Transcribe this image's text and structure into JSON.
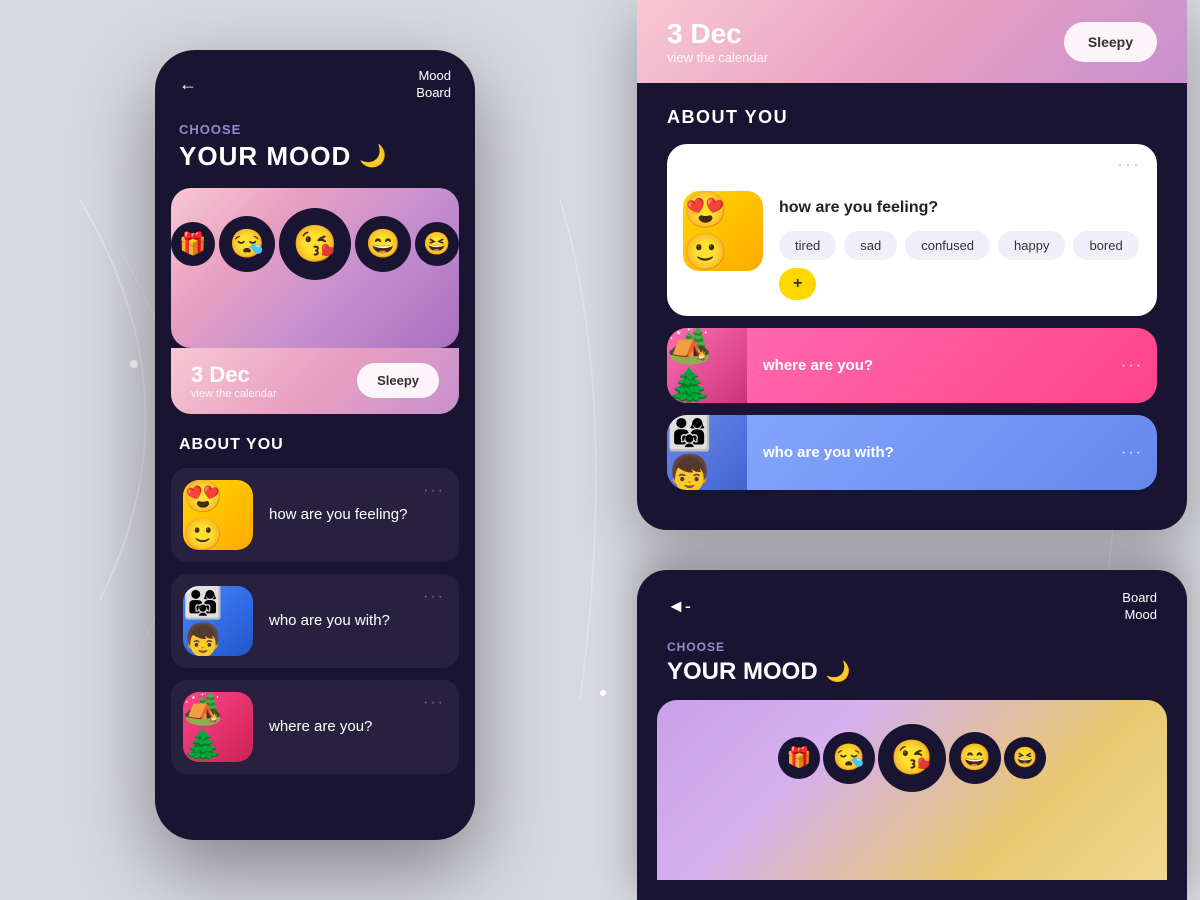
{
  "app": {
    "title": "Mood Board",
    "title_reversed": "Board Mood",
    "choose_label": "CHOOSE",
    "your_mood": "YOUR MOOD",
    "about_you": "ABOUT YOU"
  },
  "left_phone": {
    "back_arrow": "←",
    "mood_board": "Mood\nBoard",
    "choose": "CHOOSE",
    "your_mood": "YOUR MOOD",
    "moon": "🌙",
    "emojis": [
      "🎁",
      "😪",
      "😘",
      "😄",
      "😆"
    ],
    "date": "3 Dec",
    "calendar_link": "view the calendar",
    "sleepy_label": "Sleepy",
    "about_you_title": "ABOUT YOU",
    "cards": [
      {
        "emoji": "😍🙂",
        "question": "how are you feeling?",
        "color": "yellow"
      },
      {
        "emoji": "👨‍👩‍👧",
        "question": "who are you with?",
        "color": "blue"
      },
      {
        "emoji": "🏕️",
        "question": "where are you?",
        "color": "pink"
      }
    ]
  },
  "top_right": {
    "date": "3 Dec",
    "calendar_link": "view the calendar",
    "sleepy_label": "Sleepy",
    "about_you": "ABOUT YOU",
    "feeling_question": "how are you feeling?",
    "mood_tags": [
      "tired",
      "sad",
      "confused",
      "happy",
      "bored",
      "+"
    ],
    "where_question": "where are you?",
    "who_question": "who are you with?"
  },
  "bottom_right": {
    "back_arrow": "◄-",
    "board_mood": "Board\nMood",
    "choose": "CHOOSE",
    "your_mood": "YOUR MOOD",
    "moon": "🌙",
    "emojis": [
      "🎁",
      "😪",
      "😘",
      "😄",
      "😆"
    ]
  }
}
